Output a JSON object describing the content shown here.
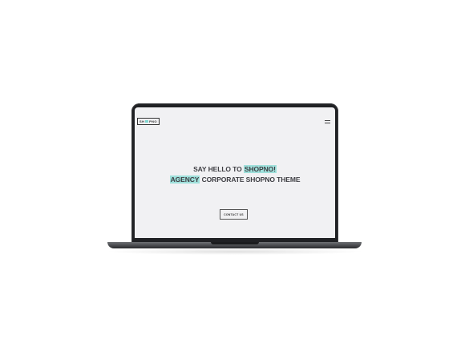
{
  "brand": {
    "logo_left": "SH",
    "logo_right": "PNO"
  },
  "hero": {
    "line1_plain": "SAY HELLO TO ",
    "line1_highlight": "SHOPNO!",
    "line2_highlight": "AGENCY",
    "line2_plain": " CORPORATE SHOPNO THEME"
  },
  "cta": {
    "label": "CONTACT US"
  },
  "colors": {
    "accent": "#9fe0db",
    "screen_bg": "#f1f1f3",
    "text": "#3f3f44",
    "bezel": "#202124"
  },
  "icons": {
    "menu": "hamburger-icon"
  }
}
